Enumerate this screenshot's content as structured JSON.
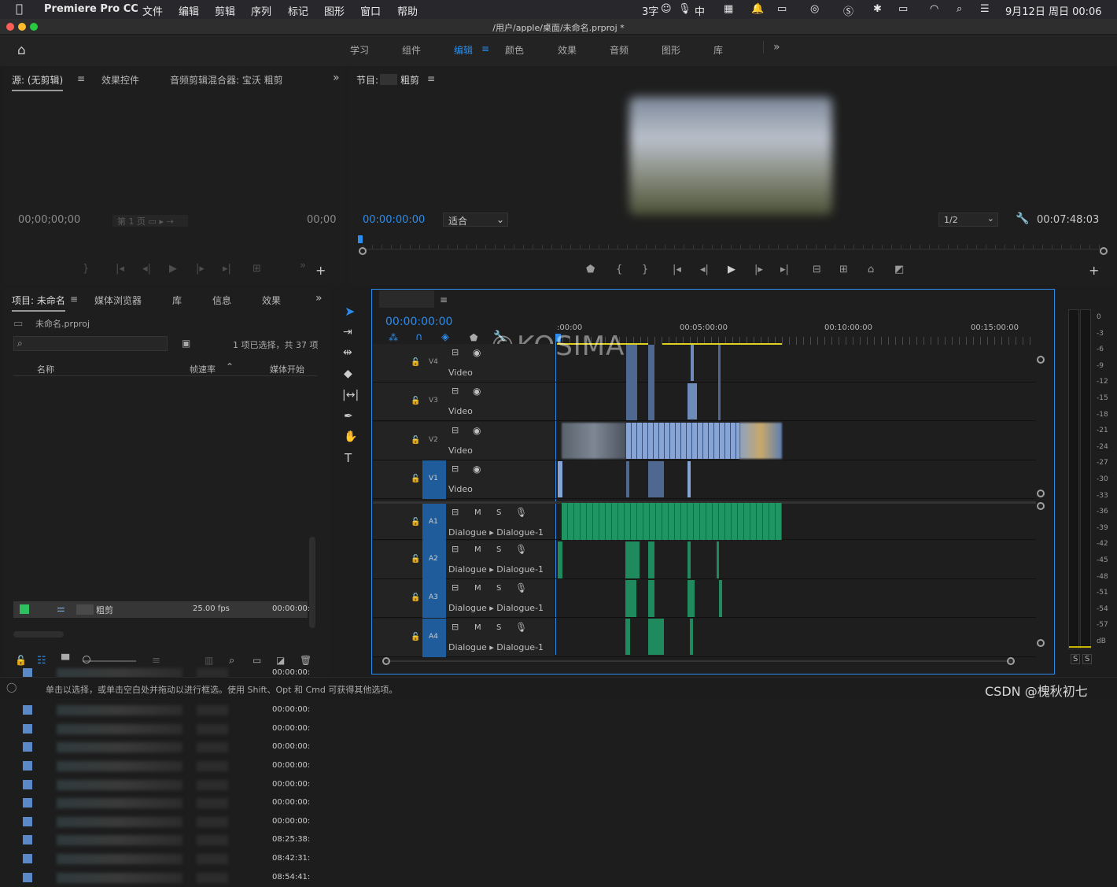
{
  "menubar": {
    "app_name": "Premiere Pro CC",
    "items": [
      "文件",
      "编辑",
      "剪辑",
      "序列",
      "标记",
      "图形",
      "窗口",
      "帮助"
    ],
    "status_ime": "3字",
    "status_zh": "中",
    "clock": "9月12日 周日 00:06"
  },
  "window": {
    "title": "/用户/apple/桌面/未命名.prproj *"
  },
  "workspaces": {
    "tabs": [
      "学习",
      "组件",
      "编辑",
      "颜色",
      "效果",
      "音频",
      "图形",
      "库"
    ],
    "active": "编辑"
  },
  "source": {
    "tabs": [
      "源: (无剪辑)",
      "效果控件",
      "音频剪辑混合器: 宝沃 粗剪"
    ],
    "timecode_in": "00;00;00;00",
    "page": "第 1 页",
    "timecode_out": "00;00"
  },
  "program": {
    "tab_prefix": "节目:",
    "tab_name": "粗剪",
    "timecode": "00:00:00:00",
    "fit": "适合",
    "resolution": "1/2",
    "duration": "00:07:48:03"
  },
  "project": {
    "tabs": [
      "项目: 未命名",
      "媒体浏览器",
      "库",
      "信息",
      "效果"
    ],
    "file": "未命名.prproj",
    "selection": "1 项已选择，共 37 项",
    "columns": [
      "名称",
      "帧速率",
      "媒体开始"
    ],
    "rows": [
      {
        "start": "00:00:00:"
      },
      {
        "start": "00:00:00:"
      },
      {
        "start": "00:00:00:"
      },
      {
        "start": "00:00:00:"
      },
      {
        "start": "00:00:00:"
      },
      {
        "start": "00:00:00:"
      },
      {
        "start": "00:00:00:"
      },
      {
        "start": "00:00:00:"
      },
      {
        "start": "00:00:00:"
      },
      {
        "start": "08:25:38:"
      },
      {
        "start": "08:42:31:"
      },
      {
        "start": "08:54:41:"
      }
    ],
    "seq_row": {
      "name": "粗剪",
      "fps": "25.00 fps",
      "start": "00:00:00:"
    }
  },
  "timeline": {
    "timecode": "00:00:00:00",
    "ruler": [
      ":00:00",
      "00:05:00:00",
      "00:10:00:00",
      "00:15:00:00"
    ],
    "video_tracks": [
      {
        "id": "V4",
        "name": "Video"
      },
      {
        "id": "V3",
        "name": "Video"
      },
      {
        "id": "V2",
        "name": "Video"
      },
      {
        "id": "V1",
        "name": "Video"
      }
    ],
    "audio_tracks": [
      {
        "id": "A1",
        "name": "Dialogue ▸ Dialogue-1"
      },
      {
        "id": "A2",
        "name": "Dialogue ▸ Dialogue-1"
      },
      {
        "id": "A3",
        "name": "Dialogue ▸ Dialogue-1"
      },
      {
        "id": "A4",
        "name": "Dialogue ▸ Dialogue-1"
      }
    ],
    "m": "M",
    "s": "S"
  },
  "meter": {
    "scale": [
      "0",
      "-3",
      "-6",
      "-9",
      "-12",
      "-15",
      "-18",
      "-21",
      "-24",
      "-27",
      "-30",
      "-33",
      "-36",
      "-39",
      "-42",
      "-45",
      "-48",
      "-51",
      "-54",
      "-57",
      "dB"
    ],
    "solo": [
      "S",
      "S"
    ]
  },
  "watermark": "©KOSIMA",
  "status": {
    "hint": "单击以选择，或单击空白处并拖动以进行框选。使用 Shift、Opt 和 Cmd 可获得其他选项。",
    "credit": "CSDN @槐秋初七"
  }
}
